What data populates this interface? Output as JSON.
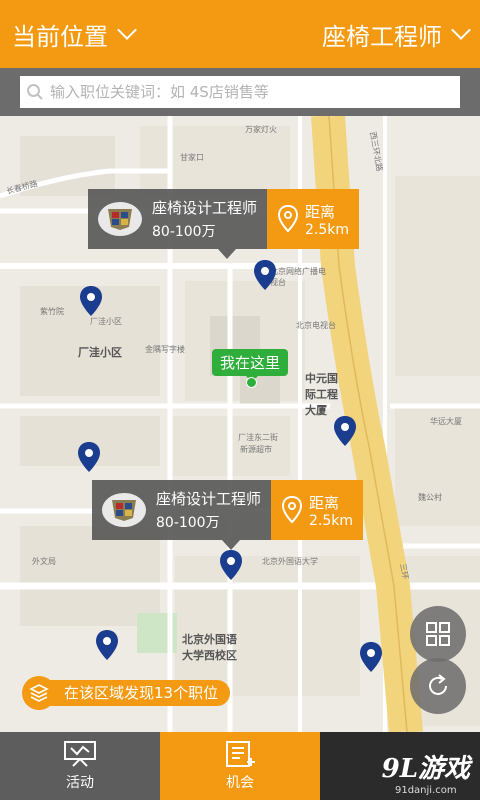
{
  "header": {
    "location_label": "当前位置",
    "job_label": "座椅工程师"
  },
  "search": {
    "placeholder": "输入职位关键词：如 4S店销售等"
  },
  "map": {
    "labels": {
      "changchun_road": "长春桥路",
      "wanjia": "万家灯火",
      "xisanhuan": "西三环北路",
      "area1": "厂洼小区",
      "area1_small": "厂洼小区",
      "jinyu": "金隅写字楼",
      "dianshitai": "北京电视台",
      "zhongyuan": "中元国际工程大厦",
      "changwa_east": "厂洼东二街",
      "beiwai_west": "北京外国语大学西校区",
      "waigong": "外文局",
      "ganjia": "甘家口",
      "hotel": "北京网络广播电视台",
      "xinyuan": "新源超市",
      "zizhuyuan": "紫竹院",
      "beiwai": "北京外国语大学",
      "sanhuan": "三环",
      "weigongcun": "魏公村",
      "huayuan": "华远大厦"
    },
    "current_location_label": "我在这里",
    "found_text": "在该区域发现13个职位"
  },
  "job_cards": [
    {
      "title": "座椅设计工程师",
      "salary": "80-100万",
      "distance_label": "距离",
      "distance_value": "2.5km"
    },
    {
      "title": "座椅设计工程师",
      "salary": "80-100万",
      "distance_label": "距离",
      "distance_value": "2.5km"
    }
  ],
  "tabs": [
    {
      "label": "活动"
    },
    {
      "label": "机会"
    },
    {
      "label": ""
    }
  ],
  "watermark": {
    "logo": "9L游戏",
    "url": "91danji.com"
  },
  "colors": {
    "brand": "#f39a12",
    "here": "#2fae3c",
    "pin": "#1a3d8f"
  },
  "icons": [
    "chevron-down-icon",
    "search-icon",
    "cadillac-logo-icon",
    "location-pin-icon",
    "layers-icon",
    "grid-icon",
    "refresh-icon",
    "activity-icon",
    "opportunity-icon"
  ]
}
